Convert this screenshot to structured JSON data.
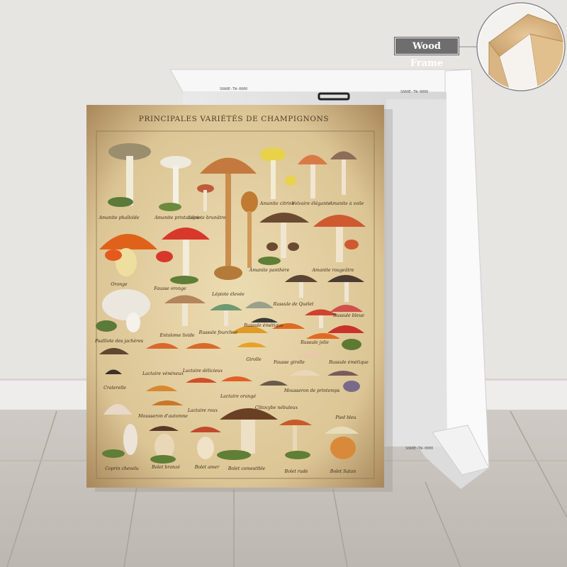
{
  "frame_label": "Wood Frame",
  "poster": {
    "title": "PRINCIPALES VARIÉTÉS DE CHAMPIGNONS",
    "mushroom_labels": [
      "Amanite phalloïde",
      "Amanite printanière",
      "Lépiote brunâtre",
      "Amanite citrine",
      "Volvaire élégante",
      "Amanite à voile",
      "Oronge",
      "Fausse oronge",
      "Lépiote élevée",
      "Amanite panthère",
      "Amanite rougeâtre",
      "Psalliote des jachères",
      "Entolome livide",
      "Russule fourchue",
      "Russule émétique",
      "Russule de Quélet",
      "Russule bleue",
      "Lactaire vénéneux",
      "Lactaire délicieux",
      "Girolle",
      "Fausse girolle",
      "Russule jolie",
      "Russule émétique",
      "Craterelle",
      "Mousseron d'automne",
      "Lactaire roux",
      "Lactaire orangé",
      "Clitocybe nébuleux",
      "Mousseron de printemps",
      "Pied bleu",
      "Coprin chevelu",
      "Bolet bronzé",
      "Bolet amer",
      "Bolet comestible",
      "Bolet rude",
      "Bolet Satan"
    ]
  },
  "colors": {
    "wall": "#e6e4e1",
    "floor": "#c9c4bf",
    "poster_paper": "#e3cfa0",
    "canvas_frame": "#f4f4f4",
    "label_bg": "#6e6e6e"
  }
}
